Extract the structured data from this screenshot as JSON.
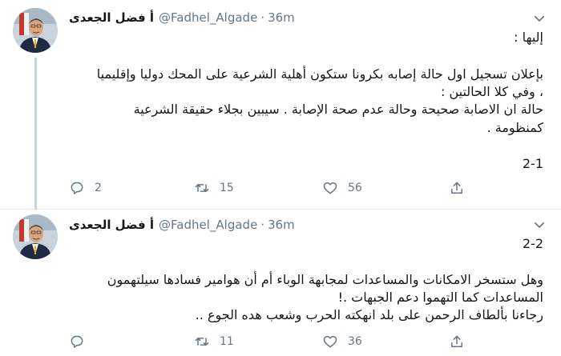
{
  "tweets": [
    {
      "author": {
        "display_name": "أ فضل الجعدى",
        "handle": "@Fadhel_Algade",
        "time": "36m"
      },
      "lines": [
        "إليها :",
        "بإعلان تسجيل اول حالة إصابه بكرونا ستكون أهلية الشرعية على المحك دوليا وإقليميا",
        "، وفي كلا الحالتين :",
        "حالة ان الاصابة صحيحة وحالة عدم صحة الإصابة . سيبين بجلاء حقيقة الشرعية",
        "كمنظومة .",
        "2-1"
      ],
      "actions": {
        "reply_count": "2",
        "retweet_count": "15",
        "like_count": "56"
      }
    },
    {
      "author": {
        "display_name": "أ فضل الجعدى",
        "handle": "@Fadhel_Algade",
        "time": "36m"
      },
      "lines": [
        "2-2",
        "وهل ستسخر الامكانات والمساعدات لمجابهة الوباء أم أن هوامير فسادها سيلتهمون",
        "المساعدات كما التهموا دعم الجبهات .!",
        "رجاءنا بألطاف الرحمن على بلد انهكته الحرب وشعب هده الجوع .."
      ],
      "actions": {
        "reply_count": "",
        "retweet_count": "11",
        "like_count": "36"
      }
    }
  ],
  "icons": {
    "reply": "reply-icon",
    "retweet": "retweet-icon",
    "like": "heart-icon",
    "share": "share-icon",
    "more": "chevron-down-icon"
  },
  "colors": {
    "text": "#14171a",
    "muted": "#657786",
    "thread_line": "#c8d3db",
    "divider": "#e6ecf0"
  }
}
